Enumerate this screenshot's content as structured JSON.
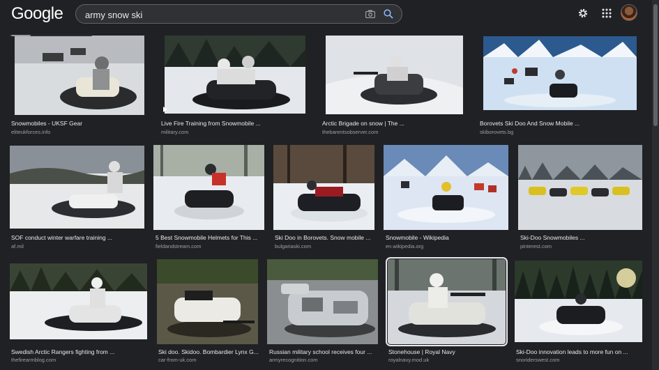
{
  "header": {
    "logo_text": "Google",
    "search_value": "army snow ski",
    "icons": [
      "camera-icon",
      "search-icon",
      "gear-icon",
      "apps-icon",
      "avatar"
    ]
  },
  "results": [
    {
      "caption": "Snowmobiles - UKSF Gear",
      "source": "eliteukforces.info"
    },
    {
      "caption": "Live Fire Training from Snowmobile ...",
      "source": "military.com"
    },
    {
      "caption": "Arctic Brigade on snow | The ...",
      "source": "thebarentsobserver.com"
    },
    {
      "caption": "Borovets Ski Doo And Snow Mobile ...",
      "source": "skiborovets.bg"
    },
    {
      "caption": "SOF conduct winter warfare training ...",
      "source": "af.mil"
    },
    {
      "caption": "5 Best Snowmobile Helmets for This ...",
      "source": "fieldandstream.com"
    },
    {
      "caption": "Ski Doo in Borovets. Snow mobile ...",
      "source": "bulgariaski.com"
    },
    {
      "caption": "Snowmobile - Wikipedia",
      "source": "en.wikipedia.org"
    },
    {
      "caption": "Ski-Doo Snowmobiles ...",
      "source": "pinterest.com"
    },
    {
      "caption": "Swedish Arctic Rangers fighting from ...",
      "source": "thefirearmblog.com"
    },
    {
      "caption": "Ski doo. Skidoo. Bombardier Lynx G...",
      "source": "car-from-uk.com"
    },
    {
      "caption": "Russian military school receives four ...",
      "source": "armyrecognition.com"
    },
    {
      "caption": "Stonehouse | Royal Navy",
      "source": "royalnavy.mod.uk"
    },
    {
      "caption": "Ski-Doo innovation leads to more fun on ...",
      "source": "snoriderswest.com"
    }
  ]
}
